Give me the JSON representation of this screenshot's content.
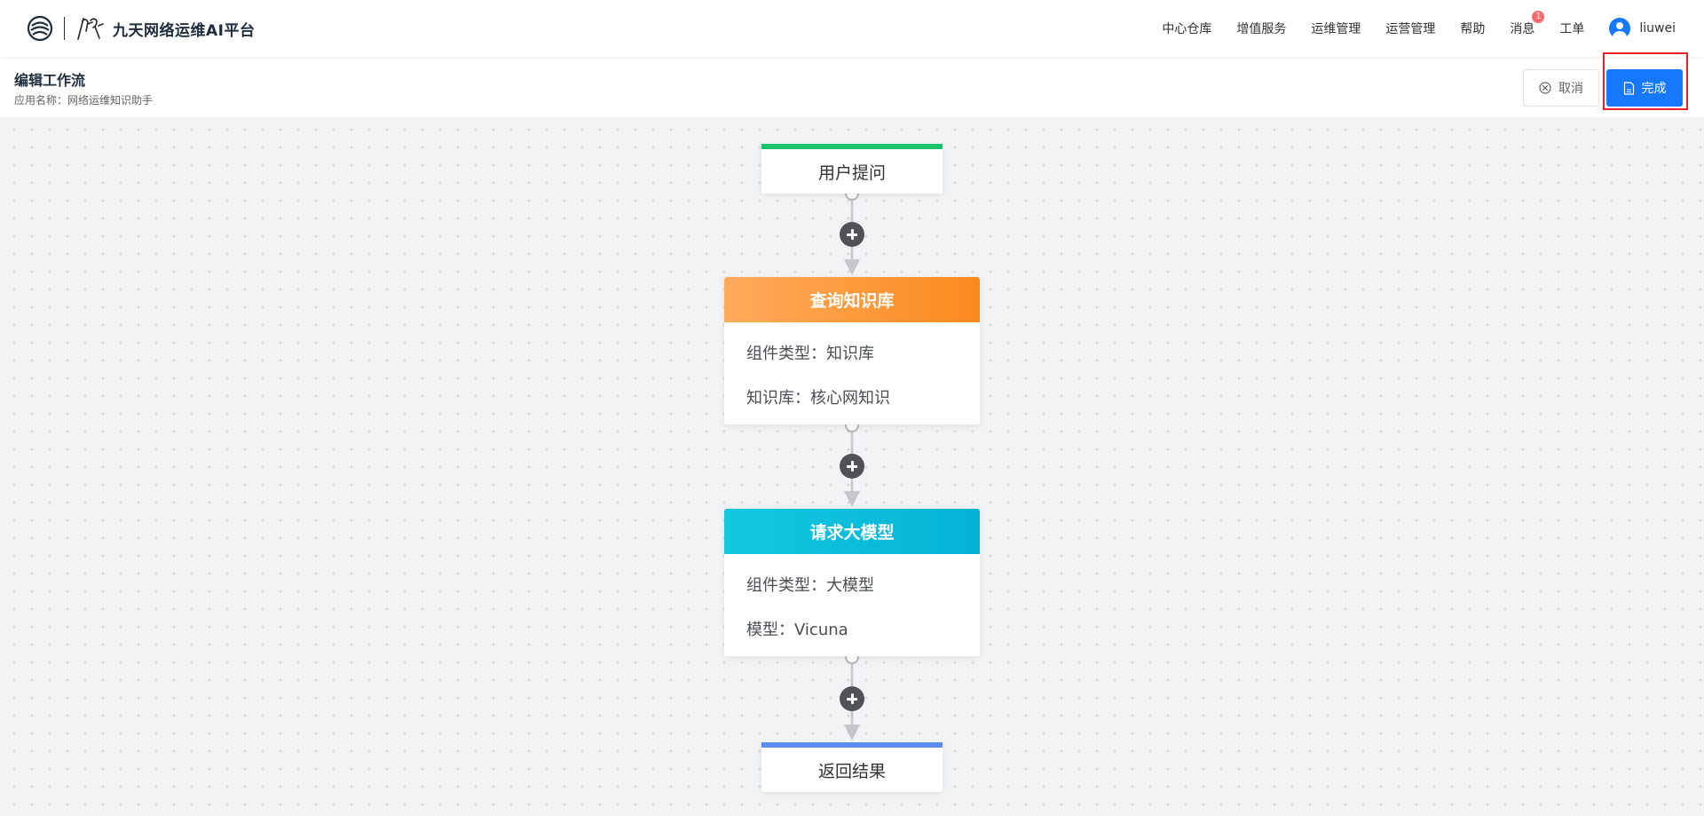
{
  "header": {
    "brand_title": "九天网络运维AI平台",
    "nav": [
      {
        "label": "中心仓库"
      },
      {
        "label": "增值服务"
      },
      {
        "label": "运维管理"
      },
      {
        "label": "运营管理"
      },
      {
        "label": "帮助"
      },
      {
        "label": "消息",
        "badge": "1"
      },
      {
        "label": "工单"
      }
    ],
    "user": {
      "name": "liuwei"
    }
  },
  "subheader": {
    "title": "编辑工作流",
    "app_name": "应用名称：网络运维知识助手",
    "cancel_label": "取消",
    "done_label": "完成"
  },
  "workflow": {
    "start": {
      "label": "用户提问",
      "accent": "#19c26b"
    },
    "nodes": [
      {
        "title": "查询知识库",
        "accent": "#fb8a1e",
        "line1": "组件类型：知识库",
        "line2": "知识库：核心网知识"
      },
      {
        "title": "请求大模型",
        "accent": "#04b2d6",
        "line1": "组件类型：大模型",
        "line2": "模型：Vicuna"
      }
    ],
    "end": {
      "label": "返回结果",
      "accent": "#5b8def"
    }
  },
  "colors": {
    "primary": "#1677ff",
    "highlight": "#e5202b",
    "badge": "#f56c6c"
  }
}
